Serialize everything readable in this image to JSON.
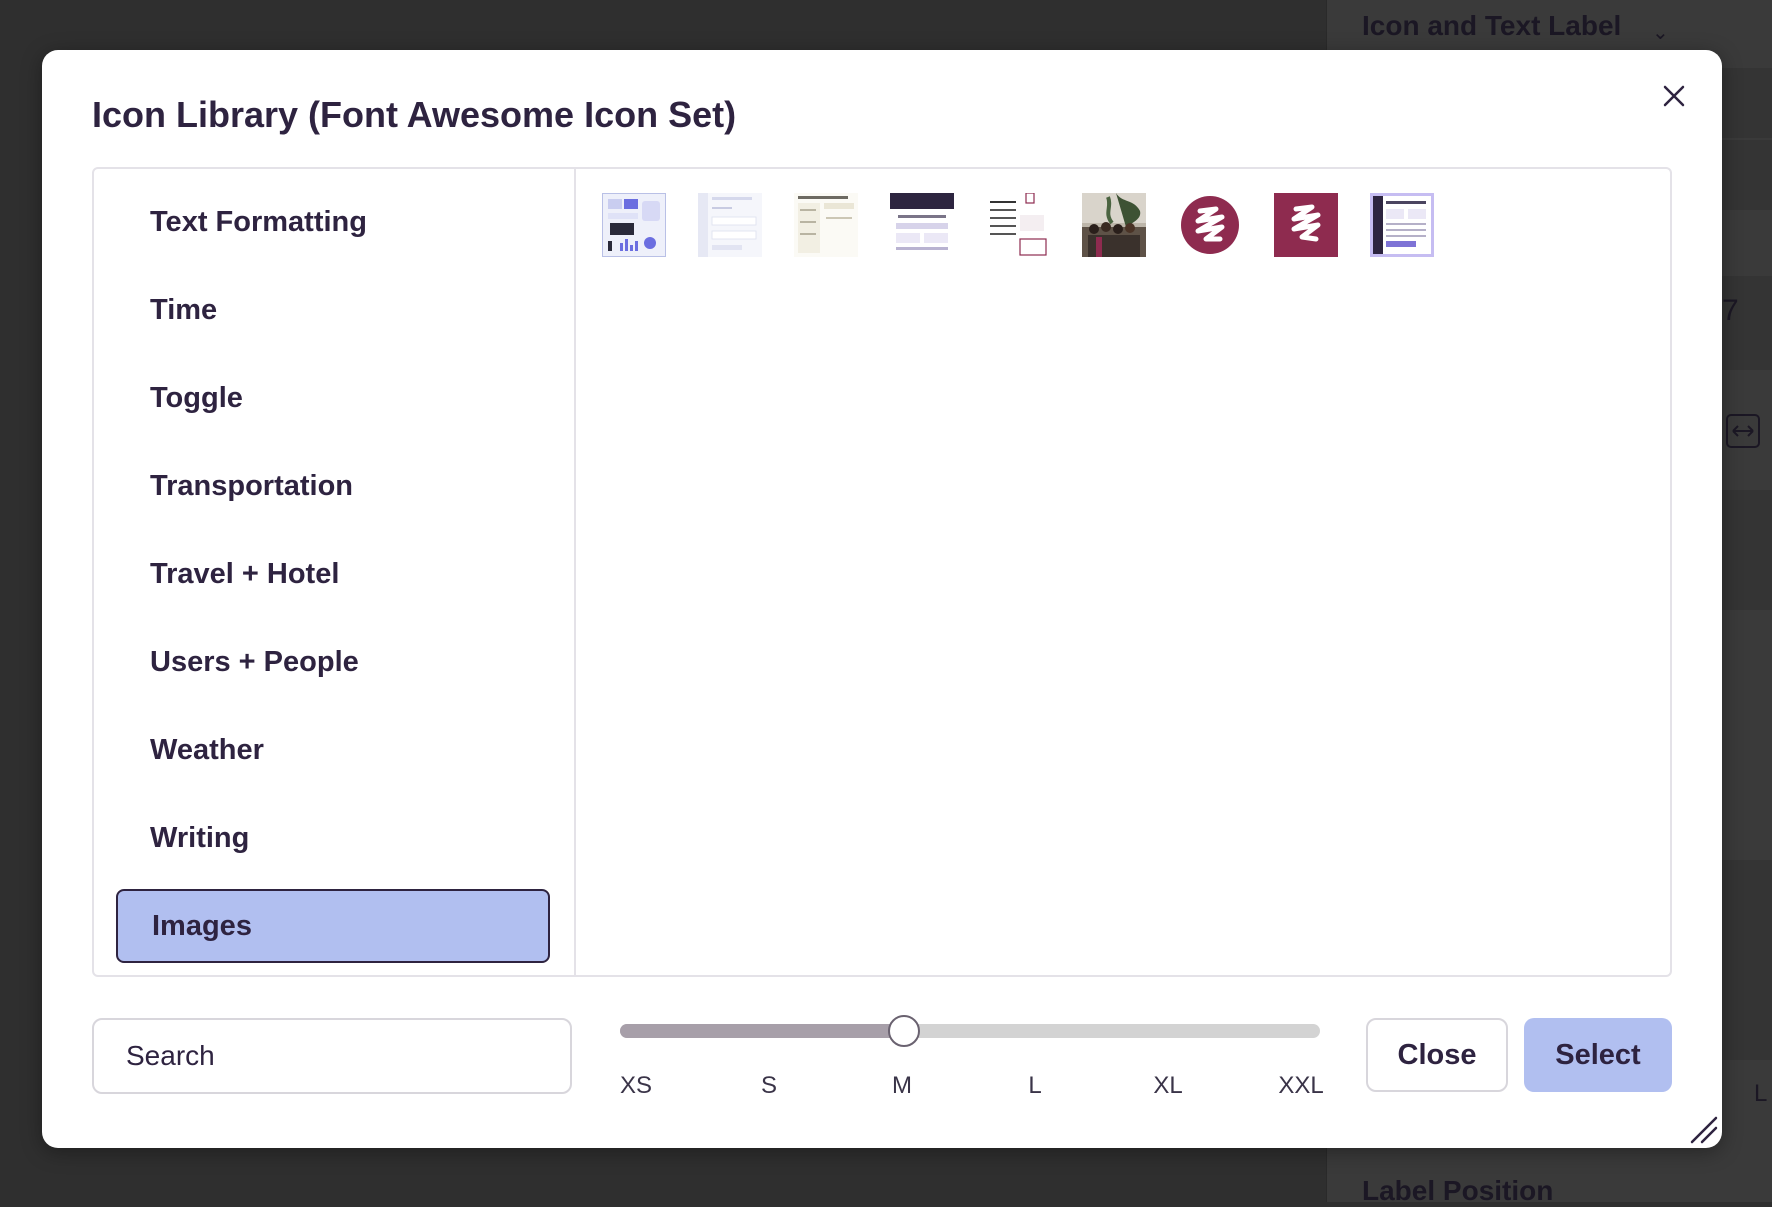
{
  "background": {
    "panel_title": "Icon and Text Label",
    "label_position": "Label Position",
    "fragment_7": "7",
    "fragment_l": "L"
  },
  "modal": {
    "title": "Icon Library (Font Awesome Icon Set)",
    "categories": [
      {
        "label": "Text Formatting",
        "active": false
      },
      {
        "label": "Time",
        "active": false
      },
      {
        "label": "Toggle",
        "active": false
      },
      {
        "label": "Transportation",
        "active": false
      },
      {
        "label": "Travel + Hotel",
        "active": false
      },
      {
        "label": "Users + People",
        "active": false
      },
      {
        "label": "Weather",
        "active": false
      },
      {
        "label": "Writing",
        "active": false
      },
      {
        "label": "Images",
        "active": true
      }
    ],
    "images_count": 9,
    "search": {
      "placeholder": "Search"
    },
    "size_slider": {
      "labels": [
        "XS",
        "S",
        "M",
        "L",
        "XL",
        "XXL"
      ],
      "selected": "M"
    },
    "buttons": {
      "close": "Close",
      "select": "Select"
    }
  },
  "colors": {
    "accent": "#b1bff0",
    "text": "#2e2340",
    "brand_maroon": "#8e2b4f"
  }
}
